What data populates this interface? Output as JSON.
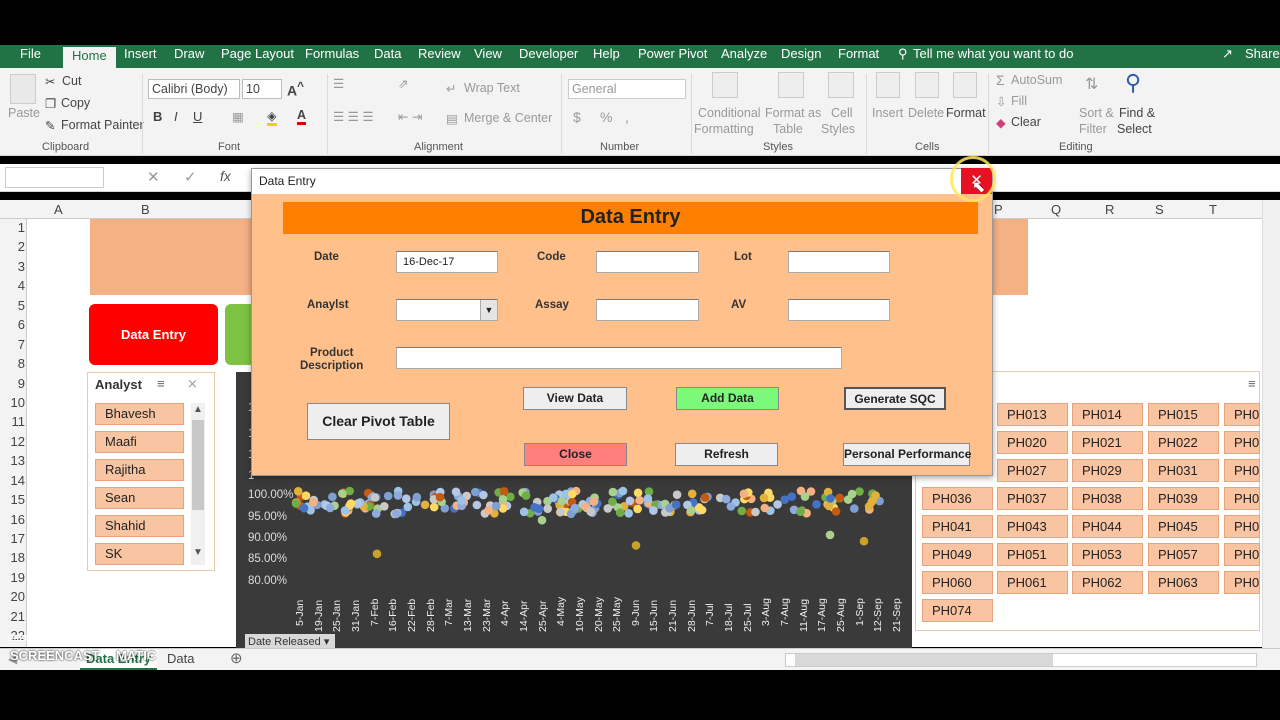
{
  "ribbon_tabs": [
    "File",
    "Home",
    "Insert",
    "Draw",
    "Page Layout",
    "Formulas",
    "Data",
    "Review",
    "View",
    "Developer",
    "Help",
    "Power Pivot",
    "Analyze",
    "Design",
    "Format"
  ],
  "tell_me": "Tell me what you want to do",
  "share": "Share",
  "clipboard": {
    "paste": "Paste",
    "cut": "Cut",
    "copy": "Copy",
    "format_painter": "Format Painter",
    "group": "Clipboard"
  },
  "font": {
    "name": "Calibri (Body)",
    "size": "10",
    "group": "Font"
  },
  "alignment": {
    "wrap": "Wrap Text",
    "merge": "Merge & Center",
    "group": "Alignment"
  },
  "number": {
    "format": "General",
    "group": "Number"
  },
  "styles": {
    "conditional": "Conditional",
    "formatting": "Formatting",
    "format_as": "Format as",
    "table": "Table",
    "cell": "Cell",
    "cell_styles": "Styles",
    "group": "Styles"
  },
  "cells": {
    "insert": "Insert",
    "delete": "Delete",
    "format": "Format",
    "group": "Cells"
  },
  "editing": {
    "autosum": "AutoSum",
    "fill": "Fill",
    "clear": "Clear",
    "sort": "Sort &",
    "filter": "Filter",
    "find": "Find &",
    "select": "Select",
    "group": "Editing"
  },
  "columns": [
    "A",
    "B",
    "P",
    "Q",
    "R",
    "S",
    "T"
  ],
  "rows": [
    "1",
    "2",
    "3",
    "4",
    "5",
    "6",
    "7",
    "8",
    "9",
    "10",
    "11",
    "12",
    "13",
    "14",
    "15",
    "16",
    "17",
    "18",
    "19",
    "20",
    "21",
    "22"
  ],
  "sheet": {
    "data_entry_button": "Data Entry"
  },
  "analyst_slicer": {
    "title": "Analyst",
    "items": [
      "Bhavesh",
      "Maafi",
      "Rajitha",
      "Sean",
      "Shahid",
      "SK"
    ]
  },
  "code_slicer_items": [
    "PH013",
    "PH014",
    "PH015",
    "PH0",
    "PH020",
    "PH021",
    "PH022",
    "PH0",
    "PH027",
    "PH029",
    "PH031",
    "PH0",
    "PH036",
    "PH037",
    "PH038",
    "PH039",
    "PH0",
    "PH041",
    "PH043",
    "PH044",
    "PH045",
    "PH0",
    "PH049",
    "PH051",
    "PH053",
    "PH057",
    "PH0",
    "PH060",
    "PH061",
    "PH062",
    "PH063",
    "PH0",
    "PH074"
  ],
  "chart_data": {
    "type": "scatter",
    "title": "",
    "y_tick_labels": [
      "100.00%",
      "95.00%",
      "90.00%",
      "85.00%",
      "80.00%"
    ],
    "ylim": [
      0.8,
      1.0
    ],
    "x_tick_labels": [
      "5-Jan",
      "19-Jan",
      "25-Jan",
      "31-Jan",
      "7-Feb",
      "16-Feb",
      "22-Feb",
      "28-Feb",
      "7-Mar",
      "13-Mar",
      "23-Mar",
      "4-Apr",
      "14-Apr",
      "25-Apr",
      "4-May",
      "10-May",
      "20-May",
      "25-May",
      "9-Jun",
      "15-Jun",
      "21-Jun",
      "28-Jun",
      "7-Jul",
      "18-Jul",
      "25-Jul",
      "3-Aug",
      "7-Aug",
      "11-Aug",
      "17-Aug",
      "25-Aug",
      "1-Sep",
      "12-Sep",
      "21-Sep"
    ],
    "filter_label": "Date Released"
  },
  "dialog": {
    "window_title": "Data Entry",
    "heading": "Data Entry",
    "labels": {
      "date": "Date",
      "code": "Code",
      "lot": "Lot",
      "analyst": "Anaylst",
      "assay": "Assay",
      "av": "AV",
      "product": "Product",
      "description": "Description"
    },
    "values": {
      "date": "16-Dec-17",
      "code": "",
      "lot": "",
      "analyst": "",
      "assay": "",
      "av": "",
      "product_description": ""
    },
    "buttons": {
      "clear_pivot": "Clear Pivot Table",
      "view_data": "View Data",
      "add_data": "Add Data",
      "generate_sqc": "Generate SQC",
      "close": "Close",
      "refresh": "Refresh",
      "personal_performance": "Personal Performance"
    }
  },
  "sheet_tabs": [
    "Data Entry",
    "Data"
  ],
  "watermark": {
    "line1": "RECORDED WITH",
    "line2": "SCREENCAST",
    "line3": "MATIC"
  }
}
